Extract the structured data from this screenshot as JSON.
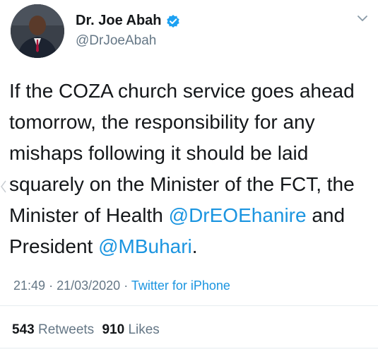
{
  "user": {
    "display_name": "Dr. Joe Abah",
    "handle": "@DrJoeAbah",
    "verified": true
  },
  "tweet": {
    "text_before_mention_1": "If the COZA church service goes ahead tomorrow, the responsibility for any mishaps following it should be laid squarely on the Minister of the FCT, the Minister of Health ",
    "mention_1": "@DrEOEhanire",
    "text_between": " and President ",
    "mention_2": "@MBuhari",
    "text_after": "."
  },
  "meta": {
    "time": "21:49",
    "separator": "·",
    "date": "21/03/2020",
    "source": "Twitter for iPhone"
  },
  "stats": {
    "retweets_count": "543",
    "retweets_label": "Retweets",
    "likes_count": "910",
    "likes_label": "Likes"
  },
  "icons": {
    "verified_badge": "verified-badge-icon",
    "caret": "chevron-down-icon",
    "nav": "chevron-left-icon"
  },
  "colors": {
    "link": "#1b95e0",
    "secondary_text": "#657786",
    "primary_text": "#14171a",
    "divider": "#e6ecf0"
  }
}
